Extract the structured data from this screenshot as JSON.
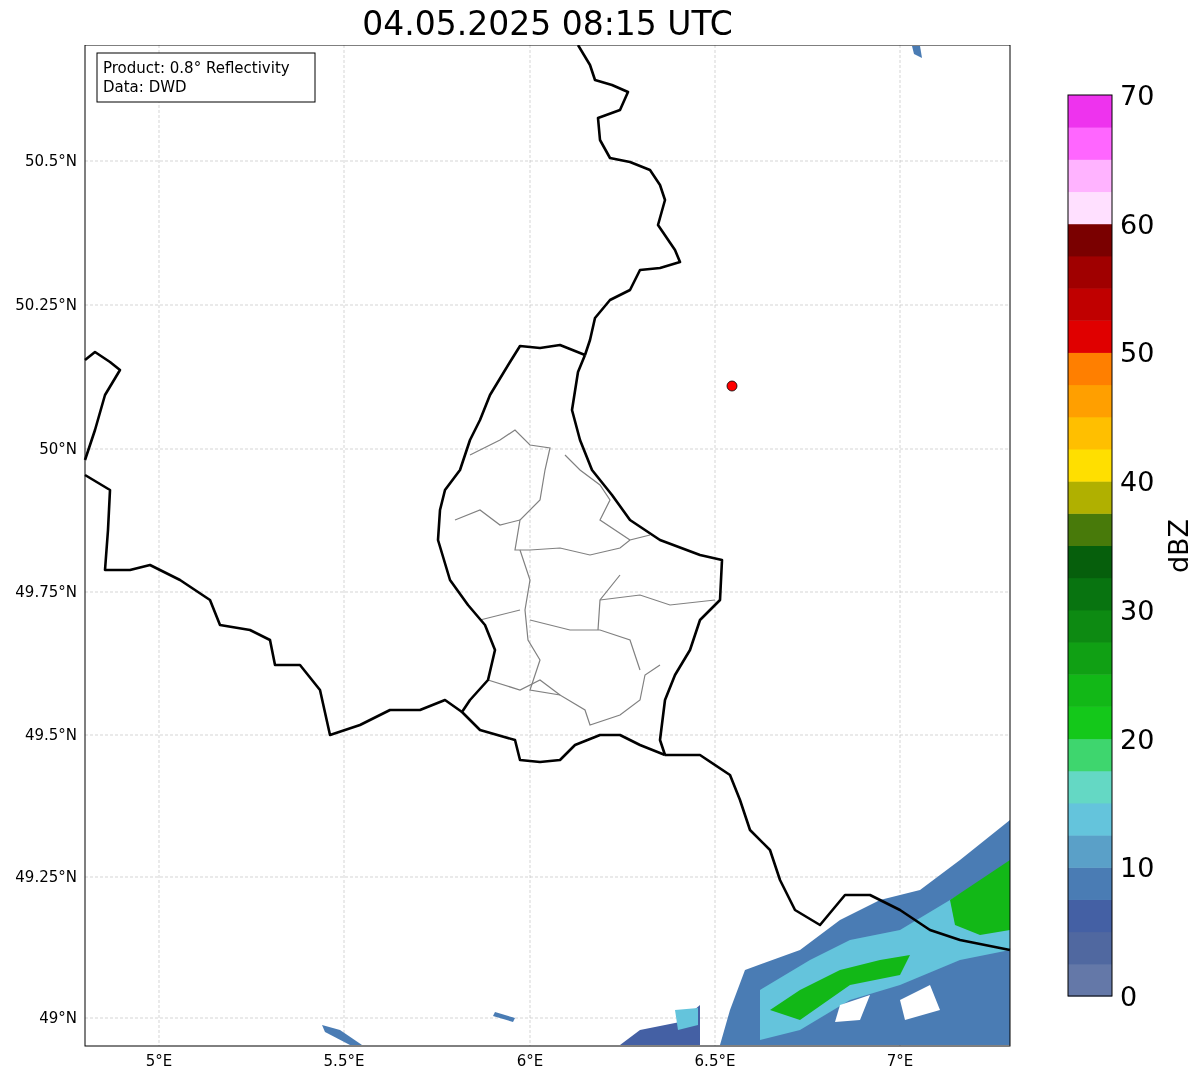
{
  "title": "04.05.2025 08:15 UTC",
  "info_box": [
    "Product: 0.8° Reflectivity",
    "Data: DWD"
  ],
  "lat_ticks": [
    "50.5°N",
    "50.25°N",
    "50°N",
    "49.75°N",
    "49.5°N",
    "49.25°N",
    "49°N"
  ],
  "lon_ticks": [
    "5°E",
    "5.5°E",
    "6°E",
    "6.5°E",
    "7°E"
  ],
  "colorbar": {
    "label": "dBZ",
    "ticks": [
      "70",
      "60",
      "50",
      "40",
      "30",
      "20",
      "10",
      "0"
    ],
    "bins": [
      {
        "color": "#6478a8"
      },
      {
        "color": "#5068a0"
      },
      {
        "color": "#4460a4"
      },
      {
        "color": "#4a7cb4"
      },
      {
        "color": "#5aa0c8"
      },
      {
        "color": "#64c4dc"
      },
      {
        "color": "#64d8c4"
      },
      {
        "color": "#3ed66e"
      },
      {
        "color": "#14c81a"
      },
      {
        "color": "#12b817"
      },
      {
        "color": "#10a014"
      },
      {
        "color": "#0d8a12"
      },
      {
        "color": "#087410"
      },
      {
        "color": "#065f0c"
      },
      {
        "color": "#487a0a"
      },
      {
        "color": "#b0b000"
      },
      {
        "color": "#ffdf00"
      },
      {
        "color": "#ffbf00"
      },
      {
        "color": "#ff9f00"
      },
      {
        "color": "#ff7f00"
      },
      {
        "color": "#e00000"
      },
      {
        "color": "#c00000"
      },
      {
        "color": "#a00000"
      },
      {
        "color": "#7a0000"
      },
      {
        "color": "#ffe0ff"
      },
      {
        "color": "#ffb3ff"
      },
      {
        "color": "#ff66ff"
      },
      {
        "color": "#ee33ee"
      }
    ]
  }
}
